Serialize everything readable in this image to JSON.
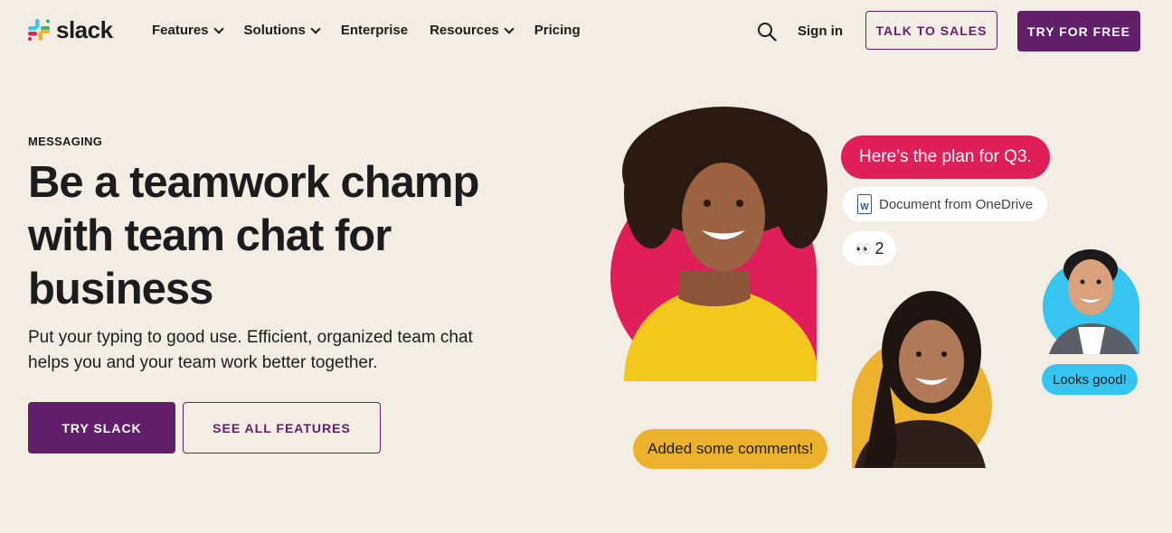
{
  "brand": {
    "name": "slack"
  },
  "nav": {
    "links": [
      {
        "label": "Features",
        "dropdown": true
      },
      {
        "label": "Solutions",
        "dropdown": true
      },
      {
        "label": "Enterprise",
        "dropdown": false
      },
      {
        "label": "Resources",
        "dropdown": true
      },
      {
        "label": "Pricing",
        "dropdown": false
      }
    ],
    "signin": "Sign in",
    "talk_to_sales": "TALK TO SALES",
    "try_for_free": "TRY FOR FREE"
  },
  "hero": {
    "eyebrow": "MESSAGING",
    "headline": "Be a teamwork champ with team chat for business",
    "subtext": "Put your typing to good use. Efficient, organized team chat helps you and your team work better together.",
    "try_button": "TRY SLACK",
    "features_button": "SEE ALL FEATURES"
  },
  "chat": {
    "plan_message": "Here’s the plan for Q3.",
    "document_label": "Document from OneDrive",
    "reaction_count": "2",
    "comments_message": "Added some comments!",
    "reply_message": "Looks good!"
  },
  "colors": {
    "aubergine": "#611f69",
    "background": "#f4ede4",
    "pink": "#e01e5a",
    "yellow": "#ecb22e",
    "blue": "#36c5f0",
    "green": "#2eb67d"
  },
  "icons": [
    "slack-logo-icon",
    "search-icon",
    "chevron-down-icon",
    "word-document-icon",
    "eyes-emoji-icon"
  ]
}
